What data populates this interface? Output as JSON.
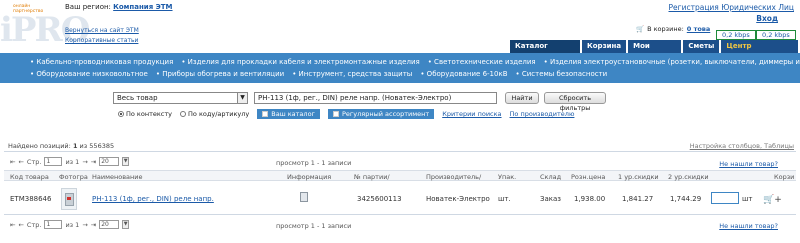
{
  "header": {
    "logo_tagline": "онлайн партнерство",
    "logo_text": "iPRO",
    "region_label": "Ваш регион:",
    "region_value": "Компания ЭТМ",
    "back_link": "Вернуться на сайт ЭТМ",
    "corp_link": "Корпоративные статьи",
    "register": "Регистрация Юридических Лиц",
    "login": "Вход",
    "cart_label": "В корзине:",
    "cart_value": "0 това",
    "speed1": "0,2 kbps",
    "speed2": "0,2 kbps"
  },
  "tabs": [
    {
      "label": "Каталог товаров"
    },
    {
      "label": "Корзина"
    },
    {
      "label": "Мои Заказы"
    },
    {
      "label": "Сметы"
    },
    {
      "label": "Центр поддержки"
    }
  ],
  "nav": {
    "row1": [
      "• Кабельно-проводниковая продукция",
      "• Изделия для прокладки кабеля и электромонтажные изделия",
      "• Светотехнические изделия",
      "• Изделия электроустановочные (розетки, выключатели, диммеры и др.)"
    ],
    "row2": [
      "• Оборудование низковольтное",
      "• Приборы обогрева и вентиляции",
      "• Инструмент, средства защиты",
      "• Оборудование 6-10кВ",
      "• Системы безопасности"
    ]
  },
  "search": {
    "scope_value": "Весь товар",
    "query": "РН-113 (1ф, рег., DIN) реле напр. (Новатек-Электро)",
    "find_button": "Найти",
    "reset_button": "Сбросить фильтры",
    "radio_context": "По контексту",
    "radio_code": "По коду/артикулу",
    "my_catalog": "Ваш каталог",
    "regular": "Регулярный ассортимент",
    "criteria": "Критерии поиска",
    "by_producer": "По производителю"
  },
  "results": {
    "found_label": "Найдено позиций:",
    "found_count": "1",
    "found_of": "из 556385",
    "settings_link": "Настройка столбцов, Таблицы",
    "page_label": "Стр.",
    "page_value": "1",
    "page_of": "из 1",
    "page_size": "20",
    "view_text": "просмотр 1 - 1 записи",
    "not_found": "Не нашли товар?",
    "nav_first": "⇤",
    "nav_prev": "←",
    "nav_next": "→",
    "nav_last": "⇥"
  },
  "table": {
    "columns": [
      "Код товара",
      "Фотогра",
      "Наименование",
      "Информация",
      "№ партии/",
      "Производитель/",
      "Упак.",
      "Склад",
      "Розн.цена",
      "1 ур.скидки",
      "2 ур.скидки",
      "Корзи"
    ],
    "row": {
      "code": "ЕТМ388646",
      "name": "РН-113 (1ф, рег., DIN) реле напр.",
      "batch": "3425600113",
      "producer": "Новатек-Электро",
      "unit": "шт.",
      "stock": "Заказ",
      "retail": "1,938.00",
      "disc1": "1,841.27",
      "disc2": "1,744.29",
      "qty_unit": "шт"
    }
  },
  "icons": {
    "cart": "🛒",
    "cart_add": "🛒+"
  },
  "colors": {
    "nav_bg": "#3e86c4",
    "tab_bg": "#1c4f8a",
    "link": "#1b5aa8",
    "support": "#f1c642"
  }
}
